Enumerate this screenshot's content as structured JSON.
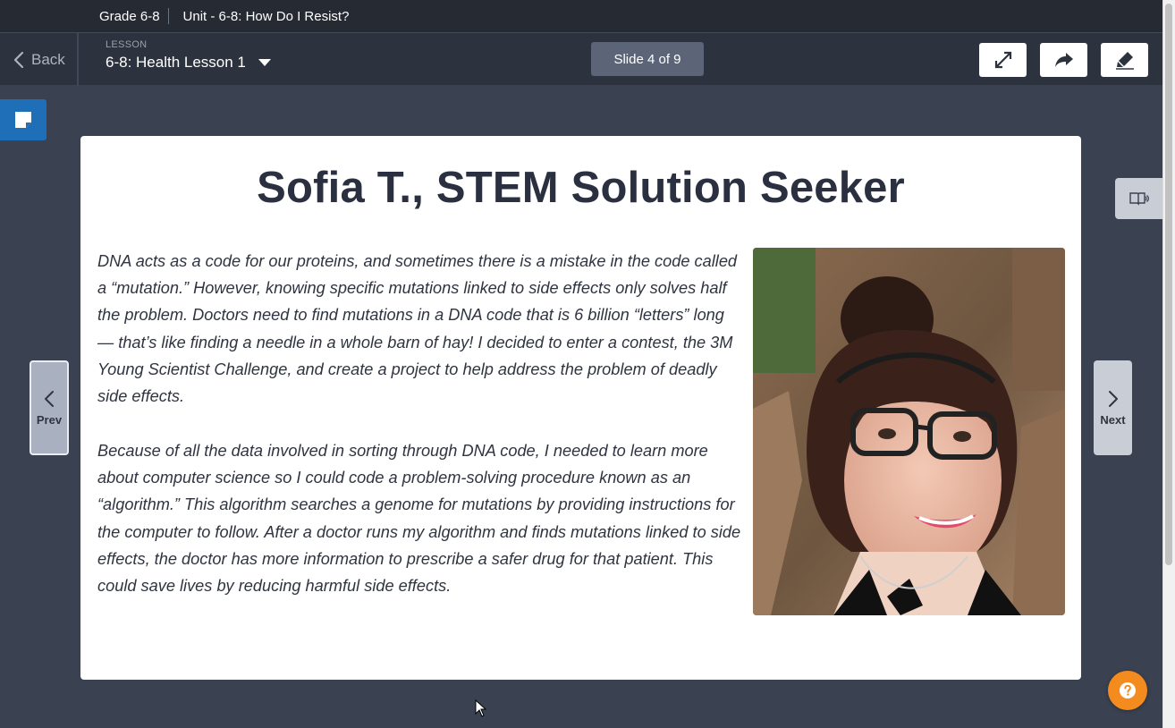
{
  "topbar": {
    "grade": "Grade 6-8",
    "unit": "Unit - 6-8: How Do I Resist?"
  },
  "lessonbar": {
    "back_label": "Back",
    "lesson_label": "LESSON",
    "lesson_title": "6-8: Health Lesson 1",
    "slide_counter": "Slide 4 of 9",
    "tools": [
      "expand-icon",
      "share-icon",
      "annotate-icon"
    ]
  },
  "slide": {
    "title": "Sofia T., STEM Solution Seeker",
    "paragraph1": "DNA acts as a code for our proteins, and sometimes there is a mistake in the code called a “mutation.” However, knowing specific mutations linked to side effects only solves half the problem. Doctors need to find mutations in a DNA code that is 6 billion “letters” long — that’s like finding a needle in a whole barn of hay! I decided to enter a contest, the 3M Young Scientist Challenge, and create a project to help address the problem of deadly side effects.",
    "paragraph2": "Because of all the data involved in sorting through DNA code, I needed to learn more about computer science so I could code a problem-solving procedure known as an “algorithm.” This algorithm searches a genome for mutations by providing instructions for the computer to follow. After a doctor runs my algorithm and finds mutations linked to side effects, the doctor has more information to prescribe a safer drug for that patient. This could save lives by reducing harmful side effects."
  },
  "nav": {
    "prev_label": "Prev",
    "next_label": "Next"
  },
  "colors": {
    "topbar": "#252a33",
    "lessonbar": "#2d333e",
    "background": "#3a4150",
    "accent_blue": "#1f6fb8",
    "help_orange": "#f38b1f"
  }
}
